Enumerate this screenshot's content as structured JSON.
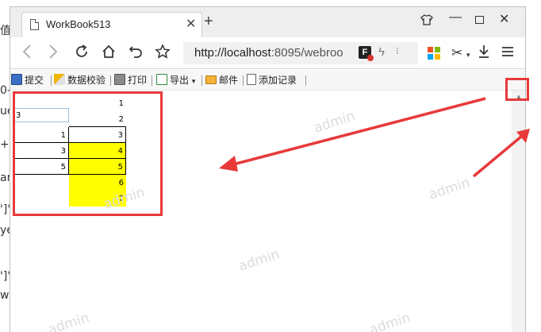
{
  "background": {
    "fragments": [
      "值",
      "0-(",
      "ue",
      "+,",
      "ar",
      "']'",
      "ye",
      "']'",
      "w"
    ]
  },
  "browser": {
    "tab_title": "WorkBook513",
    "tab_close": "✕",
    "new_tab": "+",
    "url_host": "http://localhost",
    "url_rest": ":8095/webroo",
    "f_badge": "F",
    "more_glyph": "⁝"
  },
  "toolbar": {
    "submit": "提交",
    "validate": "数据校验",
    "print": "打印",
    "export": "导出",
    "export_caret": "▾",
    "mail": "邮件",
    "add_record": "添加记录"
  },
  "sheet": {
    "input_value": "3",
    "col_a": [
      "1",
      "3",
      "5"
    ],
    "col_b": [
      "1",
      "2",
      "3",
      "4",
      "5",
      "6",
      "7"
    ]
  },
  "watermark_text": "admin",
  "colors": {
    "highlight_yellow": "#ffff00",
    "annotation_red": "#e8393a",
    "input_border": "#9bc1e6"
  },
  "icons": [
    "document-icon",
    "shirt-icon",
    "minimize-icon",
    "maximize-icon",
    "close-icon",
    "back-icon",
    "forward-icon",
    "reload-icon",
    "home-icon",
    "undo-icon",
    "star-icon",
    "save-icon",
    "ruler-icon",
    "printer-icon",
    "export-icon",
    "mail-icon",
    "add-record-icon",
    "scroll-up-icon"
  ]
}
